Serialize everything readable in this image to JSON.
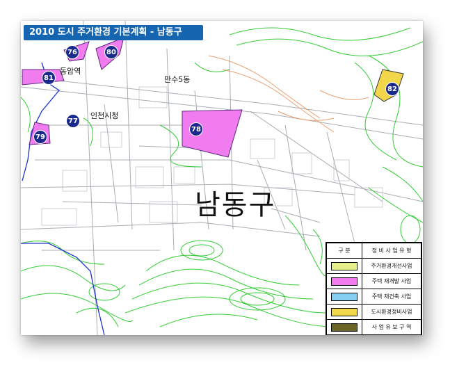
{
  "map": {
    "title": "2010 도시 주거환경 기본계획 - 남동구",
    "district": "남동구",
    "places": [
      {
        "id": "dongam-station",
        "text": "동암역"
      },
      {
        "id": "mansu5dong",
        "text": "만수5동"
      },
      {
        "id": "incheon-city-hall",
        "text": "인천시청"
      }
    ],
    "markers": [
      {
        "number": "76",
        "category": "주택 재개발 사업"
      },
      {
        "number": "80",
        "category": "주택 재개발 사업"
      },
      {
        "number": "81",
        "category": "주택 재개발 사업"
      },
      {
        "number": "77",
        "category": "주택 재개발 사업"
      },
      {
        "number": "79",
        "category": "주택 재개발 사업"
      },
      {
        "number": "78",
        "category": "주택 재개발 사업"
      },
      {
        "number": "82",
        "category": "도시환경정비사업"
      }
    ]
  },
  "legend": {
    "header_left": "구 분",
    "header_right": "정 비 사 업 유 형",
    "items": [
      {
        "label": "주거환경개선사업",
        "color": "#e6f08a"
      },
      {
        "label": "주택 재개발 사업",
        "color": "#f07cf0"
      },
      {
        "label": "주택 재건축 사업",
        "color": "#86cdf2"
      },
      {
        "label": "도시환경정비사업",
        "color": "#f2d74a"
      },
      {
        "label": "사 업 유 보 구 역",
        "color": "#6b6628"
      }
    ]
  },
  "colors": {
    "title_background": "#1565b0",
    "marker": "#1a2a8c",
    "contour": "#33cc33",
    "boundary": "#1a33cc",
    "road": "#9aa0a6",
    "contour_orange": "#e8a070"
  }
}
